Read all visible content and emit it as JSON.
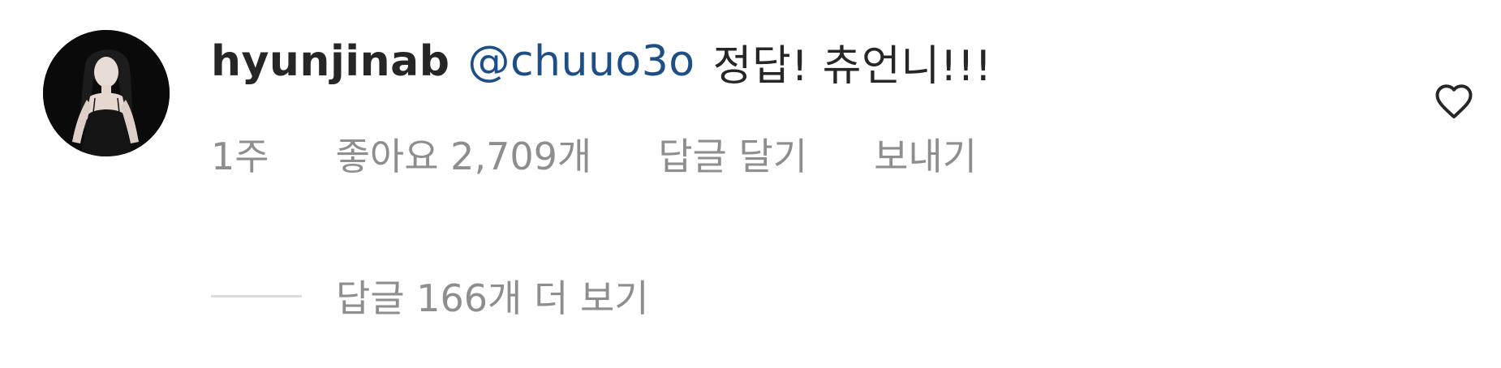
{
  "comment": {
    "username": "hyunjinab",
    "mention": "@chuuo3o",
    "text": "정답! 츄언니!!!",
    "time": "1주",
    "likes": "좋아요 2,709개",
    "reply_label": "답글 달기",
    "send_label": "보내기",
    "view_replies_label": "답글 166개 더 보기"
  },
  "icons": {
    "like": "heart-icon",
    "avatar": "profile-photo"
  },
  "colors": {
    "text": "#262626",
    "secondary": "#8e8e8e",
    "mention": "#1d4f86",
    "divider": "#dbdbdb"
  }
}
